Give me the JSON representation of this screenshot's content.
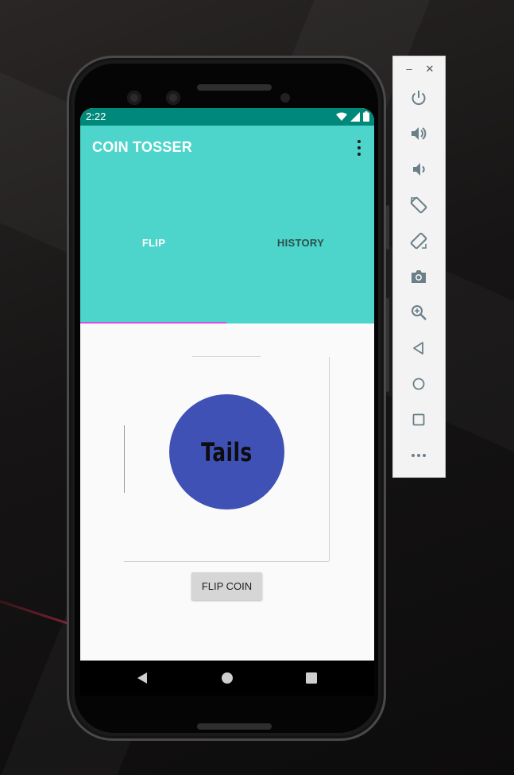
{
  "status_bar": {
    "time": "2:22"
  },
  "app_bar": {
    "title": "COIN TOSSER"
  },
  "tabs": [
    {
      "label": "FLIP",
      "selected": true
    },
    {
      "label": "HISTORY",
      "selected": false
    }
  ],
  "coin": {
    "face_text": "Tails"
  },
  "flip_button": {
    "label": "FLIP COIN"
  },
  "colors": {
    "status_bar": "#00897b",
    "app_bar": "#4dd5cb",
    "tab_indicator": "#d54ee6",
    "coin": "#3f51b5",
    "button": "#d6d6d6"
  },
  "emulator_toolbar": {
    "window_controls": [
      "minimize-icon",
      "close-icon"
    ],
    "tools": [
      "power-icon",
      "volume-up-icon",
      "volume-down-icon",
      "rotate-left-icon",
      "rotate-right-icon",
      "camera-icon",
      "zoom-icon",
      "back-icon",
      "home-icon",
      "overview-icon",
      "more-icon"
    ]
  },
  "nav_bar": {
    "buttons": [
      "back-icon",
      "home-icon",
      "recents-icon"
    ]
  }
}
